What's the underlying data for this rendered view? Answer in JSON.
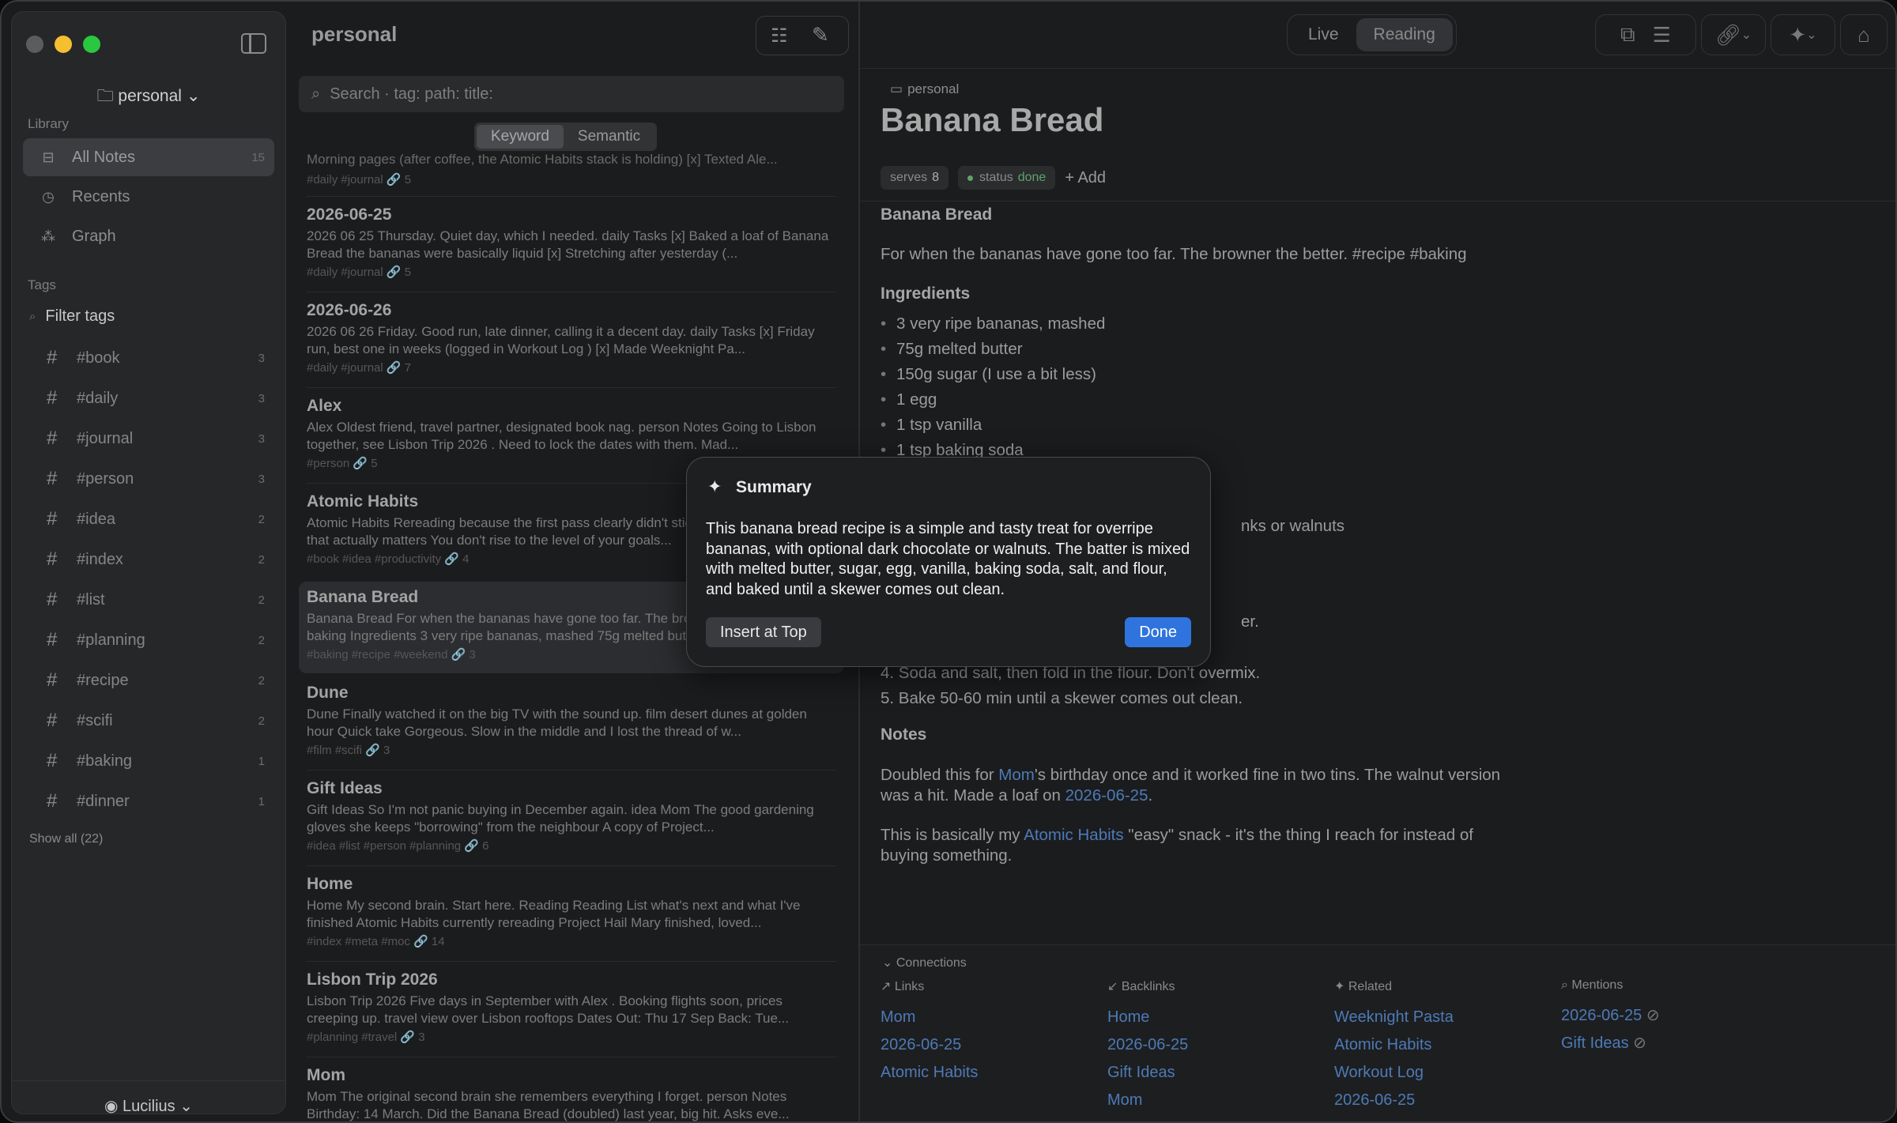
{
  "sidebar": {
    "vault": "personal",
    "library_label": "Library",
    "nav": [
      {
        "label": "All Notes",
        "count": "15",
        "icon": "inbox-icon",
        "active": true
      },
      {
        "label": "Recents",
        "count": "",
        "icon": "clock-icon"
      },
      {
        "label": "Graph",
        "count": "",
        "icon": "graph-icon"
      }
    ],
    "tags_label": "Tags",
    "filter_placeholder": "Filter tags",
    "tags": [
      {
        "name": "#book",
        "count": "3"
      },
      {
        "name": "#daily",
        "count": "3"
      },
      {
        "name": "#journal",
        "count": "3"
      },
      {
        "name": "#person",
        "count": "3"
      },
      {
        "name": "#idea",
        "count": "2"
      },
      {
        "name": "#index",
        "count": "2"
      },
      {
        "name": "#list",
        "count": "2"
      },
      {
        "name": "#planning",
        "count": "2"
      },
      {
        "name": "#recipe",
        "count": "2"
      },
      {
        "name": "#scifi",
        "count": "2"
      },
      {
        "name": "#baking",
        "count": "1"
      },
      {
        "name": "#dinner",
        "count": "1"
      }
    ],
    "show_all": "Show all (22)",
    "user": "Lucilius"
  },
  "list": {
    "title": "personal",
    "search_placeholder": "Search  ·  tag: path: title:",
    "seg": [
      "Keyword",
      "Semantic"
    ],
    "partial_top": {
      "body": "Morning pages (after coffee, the Atomic Habits stack is holding) [x] Texted Ale...",
      "meta": "#daily #journal  🔗 5"
    },
    "notes": [
      {
        "title": "2026-06-25",
        "body": "2026 06 25 Thursday. Quiet day, which I needed. daily Tasks [x] Baked a loaf of Banana Bread the bananas were basically liquid [x] Stretching after yesterday (...",
        "meta": "#daily #journal  🔗 5"
      },
      {
        "title": "2026-06-26",
        "body": "2026 06 26 Friday. Good run, late dinner, calling it a decent day. daily Tasks [x] Friday run, best one in weeks (logged in Workout Log ) [x] Made Weeknight Pa...",
        "meta": "#daily #journal  🔗 7"
      },
      {
        "title": "Alex",
        "body": "Alex Oldest friend, travel partner, designated book nag. person Notes Going to Lisbon together, see Lisbon Trip 2026 . Need to lock the dates with them. Mad...",
        "meta": "#person  🔗 5"
      },
      {
        "title": "Atomic Habits",
        "body": "Atomic Habits Rereading because the first pass clearly didn't stick. book idea productivity that actually matters You don't rise to the level of your goals...",
        "meta": "#book #idea #productivity  🔗 4"
      },
      {
        "title": "Banana Bread",
        "body": "Banana Bread For when the bananas have gone too far. The browner the better. recipe baking Ingredients 3 very ripe bananas, mashed 75g melted butter...",
        "meta": "#baking #recipe #weekend  🔗 3",
        "selected": true
      },
      {
        "title": "Dune",
        "body": "Dune Finally watched it on the big TV with the sound up. film desert dunes at golden hour Quick take Gorgeous. Slow in the middle and I lost the thread of w...",
        "meta": "#film #scifi  🔗 3"
      },
      {
        "title": "Gift Ideas",
        "body": "Gift Ideas So I'm not panic buying in December again. idea Mom The good gardening gloves she keeps \"borrowing\" from the neighbour A copy of Project...",
        "meta": "#idea #list #person #planning  🔗 6"
      },
      {
        "title": "Home",
        "body": "Home My second brain. Start here. Reading Reading List what's next and what I've finished Atomic Habits currently rereading Project Hail Mary finished, loved...",
        "meta": "#index #meta #moc  🔗 14"
      },
      {
        "title": "Lisbon Trip 2026",
        "body": "Lisbon Trip 2026 Five days in September with Alex . Booking flights soon, prices creeping up. travel view over Lisbon rooftops Dates Out: Thu 17 Sep Back: Tue...",
        "meta": "#planning #travel  🔗 3"
      },
      {
        "title": "Mom",
        "body": "Mom The original second brain she remembers everything I forget. person Notes Birthday: 14 March. Did the Banana Bread (doubled) last year, big hit. Asks eve...",
        "meta": ""
      }
    ]
  },
  "editor": {
    "modes": [
      "Live",
      "Reading"
    ],
    "active_mode": "Reading",
    "breadcrumb": "personal",
    "title": "Banana Bread",
    "props": {
      "serves_label": "serves",
      "serves_value": "8",
      "status_label": "status",
      "status_value": "done",
      "add": "Add"
    },
    "body": {
      "h1": "Banana Bread",
      "intro": "For when the bananas have gone too far. The browner the better. #recipe #baking",
      "ingredients_h": "Ingredients",
      "ingredients": [
        "3 very ripe bananas, mashed",
        "75g melted butter",
        "150g sugar (I use a bit less)",
        "1 egg",
        "1 tsp vanilla",
        "1 tsp baking soda"
      ],
      "partial_walnuts": "nks or walnuts",
      "partial_er": "er.",
      "step4": "4.  Soda and salt, then fold in the flour. Don't overmix.",
      "step5": "5.  Bake 50-60 min until a skewer comes out clean.",
      "notes_h": "Notes",
      "n1_a": "Doubled this for ",
      "n1_link1": "Mom",
      "n1_b": "'s birthday once and it worked fine in two tins. The walnut version was a hit. Made a loaf on ",
      "n1_link2": "2026-06-25",
      "n1_c": ".",
      "n2_a": "This is basically my ",
      "n2_link": "Atomic Habits",
      "n2_b": " \"easy\" snack - it's the thing I reach for instead of buying something."
    },
    "connections": {
      "title": "Connections",
      "links": {
        "label": "Links",
        "items": [
          "Mom",
          "2026-06-25",
          "Atomic Habits"
        ]
      },
      "backlinks": {
        "label": "Backlinks",
        "items": [
          "Home",
          "2026-06-25",
          "Gift Ideas",
          "Mom"
        ]
      },
      "related": {
        "label": "Related",
        "items": [
          "Weeknight Pasta",
          "Atomic Habits",
          "Workout Log",
          "2026-06-25"
        ]
      },
      "mentions": {
        "label": "Mentions",
        "items": [
          "2026-06-25",
          "Gift Ideas"
        ]
      }
    }
  },
  "summary": {
    "title": "Summary",
    "text": "This banana bread recipe is a simple and tasty treat for overripe bananas, with optional dark chocolate or walnuts. The batter is mixed with melted butter, sugar, egg, vanilla, baking soda, salt, and flour, and baked until a skewer comes out clean.",
    "insert": "Insert at Top",
    "done": "Done"
  },
  "colors": {
    "accent": "#2f74de",
    "link": "#4d7ab6",
    "status": "#5fa36a"
  }
}
